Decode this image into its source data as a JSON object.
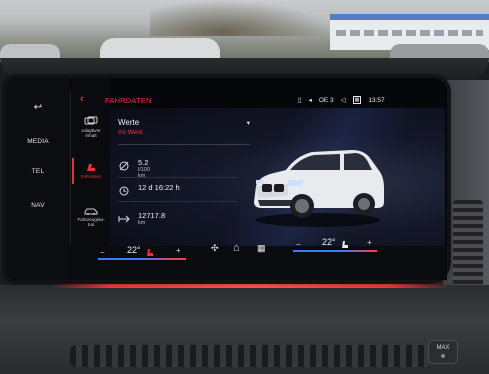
{
  "rail": {
    "back_glyph": "↩",
    "items": [
      "MEDIA",
      "TEL",
      "NAV"
    ]
  },
  "subnav": {
    "back_glyph": "‹",
    "items": [
      {
        "label_line1": "Adaptiver",
        "label_line2": "Inhalt",
        "icon": "adaptive-content-icon"
      },
      {
        "label_line1": "Fahrdaten",
        "label_line2": "",
        "icon": "seat-icon",
        "active": true
      },
      {
        "label_line1": "Fahrzeugsta-",
        "label_line2": "tus",
        "icon": "car-status-icon"
      }
    ]
  },
  "header": {
    "title": "FAHRDATEN",
    "status": {
      "phone_glyph": "▯",
      "nav_glyph": "◂",
      "station": "OE 3",
      "speaker_glyph": "◁",
      "box_label": "▦",
      "time": "13:57"
    }
  },
  "dropdown": {
    "label": "Werte",
    "value": "Ab Werk",
    "caret": "▾"
  },
  "stats": {
    "fuel_value": "5.2",
    "fuel_unit": "l/100 km",
    "time_value": "12 d 16:22 h",
    "distance_value": "12717.8",
    "distance_unit": "km"
  },
  "climate": {
    "left_temp": "22°",
    "right_temp": "22°",
    "minus": "−",
    "plus": "+",
    "fan_glyph": "✣",
    "home_glyph": "⌂",
    "grid_glyph": "▦"
  },
  "dashboard": {
    "max_label_top": "MAX",
    "max_label_bottom": "❄"
  },
  "colors": {
    "accent_red": "#e8323b",
    "climate_blue": "#3b7cff"
  }
}
